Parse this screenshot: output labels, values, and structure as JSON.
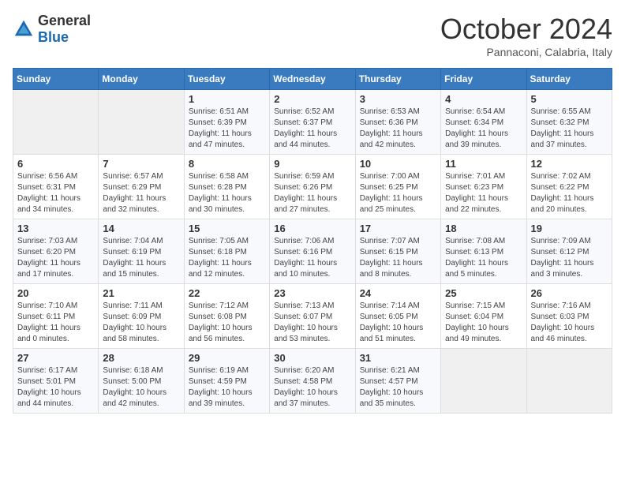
{
  "header": {
    "logo": {
      "general": "General",
      "blue": "Blue"
    },
    "title": "October 2024",
    "subtitle": "Pannaconi, Calabria, Italy"
  },
  "days_of_week": [
    "Sunday",
    "Monday",
    "Tuesday",
    "Wednesday",
    "Thursday",
    "Friday",
    "Saturday"
  ],
  "weeks": [
    [
      {
        "day": null
      },
      {
        "day": null
      },
      {
        "day": 1,
        "sunrise": "Sunrise: 6:51 AM",
        "sunset": "Sunset: 6:39 PM",
        "daylight": "Daylight: 11 hours and 47 minutes."
      },
      {
        "day": 2,
        "sunrise": "Sunrise: 6:52 AM",
        "sunset": "Sunset: 6:37 PM",
        "daylight": "Daylight: 11 hours and 44 minutes."
      },
      {
        "day": 3,
        "sunrise": "Sunrise: 6:53 AM",
        "sunset": "Sunset: 6:36 PM",
        "daylight": "Daylight: 11 hours and 42 minutes."
      },
      {
        "day": 4,
        "sunrise": "Sunrise: 6:54 AM",
        "sunset": "Sunset: 6:34 PM",
        "daylight": "Daylight: 11 hours and 39 minutes."
      },
      {
        "day": 5,
        "sunrise": "Sunrise: 6:55 AM",
        "sunset": "Sunset: 6:32 PM",
        "daylight": "Daylight: 11 hours and 37 minutes."
      }
    ],
    [
      {
        "day": 6,
        "sunrise": "Sunrise: 6:56 AM",
        "sunset": "Sunset: 6:31 PM",
        "daylight": "Daylight: 11 hours and 34 minutes."
      },
      {
        "day": 7,
        "sunrise": "Sunrise: 6:57 AM",
        "sunset": "Sunset: 6:29 PM",
        "daylight": "Daylight: 11 hours and 32 minutes."
      },
      {
        "day": 8,
        "sunrise": "Sunrise: 6:58 AM",
        "sunset": "Sunset: 6:28 PM",
        "daylight": "Daylight: 11 hours and 30 minutes."
      },
      {
        "day": 9,
        "sunrise": "Sunrise: 6:59 AM",
        "sunset": "Sunset: 6:26 PM",
        "daylight": "Daylight: 11 hours and 27 minutes."
      },
      {
        "day": 10,
        "sunrise": "Sunrise: 7:00 AM",
        "sunset": "Sunset: 6:25 PM",
        "daylight": "Daylight: 11 hours and 25 minutes."
      },
      {
        "day": 11,
        "sunrise": "Sunrise: 7:01 AM",
        "sunset": "Sunset: 6:23 PM",
        "daylight": "Daylight: 11 hours and 22 minutes."
      },
      {
        "day": 12,
        "sunrise": "Sunrise: 7:02 AM",
        "sunset": "Sunset: 6:22 PM",
        "daylight": "Daylight: 11 hours and 20 minutes."
      }
    ],
    [
      {
        "day": 13,
        "sunrise": "Sunrise: 7:03 AM",
        "sunset": "Sunset: 6:20 PM",
        "daylight": "Daylight: 11 hours and 17 minutes."
      },
      {
        "day": 14,
        "sunrise": "Sunrise: 7:04 AM",
        "sunset": "Sunset: 6:19 PM",
        "daylight": "Daylight: 11 hours and 15 minutes."
      },
      {
        "day": 15,
        "sunrise": "Sunrise: 7:05 AM",
        "sunset": "Sunset: 6:18 PM",
        "daylight": "Daylight: 11 hours and 12 minutes."
      },
      {
        "day": 16,
        "sunrise": "Sunrise: 7:06 AM",
        "sunset": "Sunset: 6:16 PM",
        "daylight": "Daylight: 11 hours and 10 minutes."
      },
      {
        "day": 17,
        "sunrise": "Sunrise: 7:07 AM",
        "sunset": "Sunset: 6:15 PM",
        "daylight": "Daylight: 11 hours and 8 minutes."
      },
      {
        "day": 18,
        "sunrise": "Sunrise: 7:08 AM",
        "sunset": "Sunset: 6:13 PM",
        "daylight": "Daylight: 11 hours and 5 minutes."
      },
      {
        "day": 19,
        "sunrise": "Sunrise: 7:09 AM",
        "sunset": "Sunset: 6:12 PM",
        "daylight": "Daylight: 11 hours and 3 minutes."
      }
    ],
    [
      {
        "day": 20,
        "sunrise": "Sunrise: 7:10 AM",
        "sunset": "Sunset: 6:11 PM",
        "daylight": "Daylight: 11 hours and 0 minutes."
      },
      {
        "day": 21,
        "sunrise": "Sunrise: 7:11 AM",
        "sunset": "Sunset: 6:09 PM",
        "daylight": "Daylight: 10 hours and 58 minutes."
      },
      {
        "day": 22,
        "sunrise": "Sunrise: 7:12 AM",
        "sunset": "Sunset: 6:08 PM",
        "daylight": "Daylight: 10 hours and 56 minutes."
      },
      {
        "day": 23,
        "sunrise": "Sunrise: 7:13 AM",
        "sunset": "Sunset: 6:07 PM",
        "daylight": "Daylight: 10 hours and 53 minutes."
      },
      {
        "day": 24,
        "sunrise": "Sunrise: 7:14 AM",
        "sunset": "Sunset: 6:05 PM",
        "daylight": "Daylight: 10 hours and 51 minutes."
      },
      {
        "day": 25,
        "sunrise": "Sunrise: 7:15 AM",
        "sunset": "Sunset: 6:04 PM",
        "daylight": "Daylight: 10 hours and 49 minutes."
      },
      {
        "day": 26,
        "sunrise": "Sunrise: 7:16 AM",
        "sunset": "Sunset: 6:03 PM",
        "daylight": "Daylight: 10 hours and 46 minutes."
      }
    ],
    [
      {
        "day": 27,
        "sunrise": "Sunrise: 6:17 AM",
        "sunset": "Sunset: 5:01 PM",
        "daylight": "Daylight: 10 hours and 44 minutes."
      },
      {
        "day": 28,
        "sunrise": "Sunrise: 6:18 AM",
        "sunset": "Sunset: 5:00 PM",
        "daylight": "Daylight: 10 hours and 42 minutes."
      },
      {
        "day": 29,
        "sunrise": "Sunrise: 6:19 AM",
        "sunset": "Sunset: 4:59 PM",
        "daylight": "Daylight: 10 hours and 39 minutes."
      },
      {
        "day": 30,
        "sunrise": "Sunrise: 6:20 AM",
        "sunset": "Sunset: 4:58 PM",
        "daylight": "Daylight: 10 hours and 37 minutes."
      },
      {
        "day": 31,
        "sunrise": "Sunrise: 6:21 AM",
        "sunset": "Sunset: 4:57 PM",
        "daylight": "Daylight: 10 hours and 35 minutes."
      },
      {
        "day": null
      },
      {
        "day": null
      }
    ]
  ]
}
